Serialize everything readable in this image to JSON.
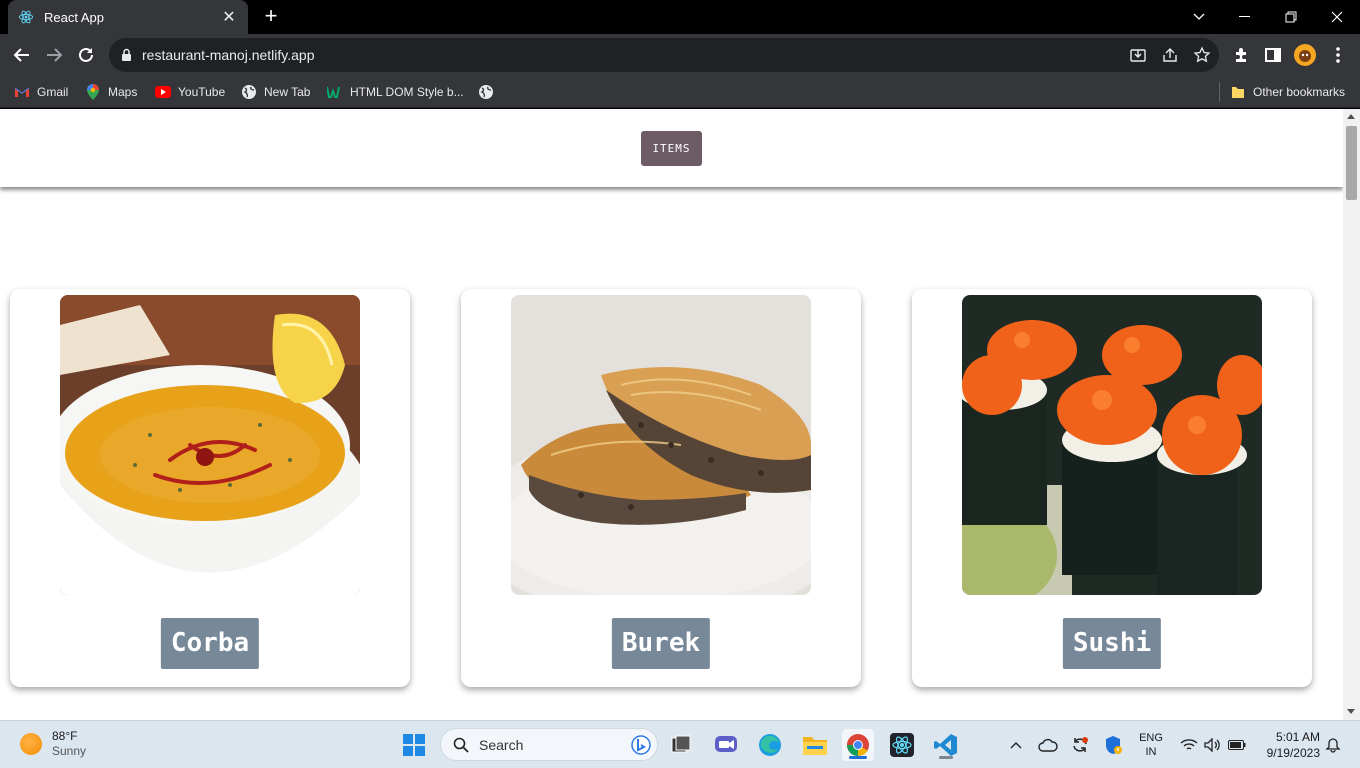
{
  "browser": {
    "tab_title": "React App",
    "url": "restaurant-manoj.netlify.app",
    "bookmarks": [
      "Gmail",
      "Maps",
      "YouTube",
      "New Tab",
      "HTML DOM Style b..."
    ],
    "other_bookmarks": "Other bookmarks"
  },
  "page": {
    "nav_button": "ITEMS",
    "cards": [
      {
        "name": "Corba"
      },
      {
        "name": "Burek"
      },
      {
        "name": "Sushi"
      }
    ]
  },
  "taskbar": {
    "weather_temp": "88°F",
    "weather_cond": "Sunny",
    "search_label": "Search",
    "lang_top": "ENG",
    "lang_bottom": "IN",
    "time": "5:01 AM",
    "date": "9/19/2023"
  },
  "colors": {
    "items_button": "#6d5b66",
    "card_label": "#778899"
  }
}
